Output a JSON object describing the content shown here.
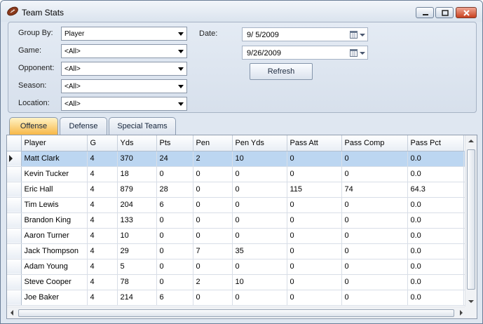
{
  "window": {
    "title": "Team Stats"
  },
  "filters": {
    "group_by_label": "Group By:",
    "group_by_value": "Player",
    "game_label": "Game:",
    "game_value": "<All>",
    "opponent_label": "Opponent:",
    "opponent_value": "<All>",
    "season_label": "Season:",
    "season_value": "<All>",
    "location_label": "Location:",
    "location_value": "<All>",
    "date_label": "Date:",
    "date_from": "9/  5/2009",
    "date_to": "9/26/2009",
    "refresh_label": "Refresh"
  },
  "tabs": [
    {
      "label": "Offense",
      "active": true
    },
    {
      "label": "Defense",
      "active": false
    },
    {
      "label": "Special Teams",
      "active": false
    }
  ],
  "table": {
    "columns": [
      "Player",
      "G",
      "Yds",
      "Pts",
      "Pen",
      "Pen Yds",
      "Pass Att",
      "Pass Comp",
      "Pass Pct"
    ],
    "selected_row": 0,
    "rows": [
      [
        "Matt Clark",
        "4",
        "370",
        "24",
        "2",
        "10",
        "0",
        "0",
        "0.0"
      ],
      [
        "Kevin Tucker",
        "4",
        "18",
        "0",
        "0",
        "0",
        "0",
        "0",
        "0.0"
      ],
      [
        "Eric Hall",
        "4",
        "879",
        "28",
        "0",
        "0",
        "115",
        "74",
        "64.3"
      ],
      [
        "Tim Lewis",
        "4",
        "204",
        "6",
        "0",
        "0",
        "0",
        "0",
        "0.0"
      ],
      [
        "Brandon King",
        "4",
        "133",
        "0",
        "0",
        "0",
        "0",
        "0",
        "0.0"
      ],
      [
        "Aaron Turner",
        "4",
        "10",
        "0",
        "0",
        "0",
        "0",
        "0",
        "0.0"
      ],
      [
        "Jack Thompson",
        "4",
        "29",
        "0",
        "7",
        "35",
        "0",
        "0",
        "0.0"
      ],
      [
        "Adam Young",
        "4",
        "5",
        "0",
        "0",
        "0",
        "0",
        "0",
        "0.0"
      ],
      [
        "Steve Cooper",
        "4",
        "78",
        "0",
        "2",
        "10",
        "0",
        "0",
        "0.0"
      ],
      [
        "Joe Baker",
        "4",
        "214",
        "6",
        "0",
        "0",
        "0",
        "0",
        "0.0"
      ]
    ]
  },
  "colors": {
    "selected_row": "#bcd6f1",
    "active_tab": "#f7b542",
    "close_button": "#c8401f"
  },
  "icons": [
    "football-icon",
    "minimize-icon",
    "maximize-icon",
    "close-icon",
    "calendar-icon",
    "dropdown-arrow-icon",
    "row-pointer-icon"
  ]
}
